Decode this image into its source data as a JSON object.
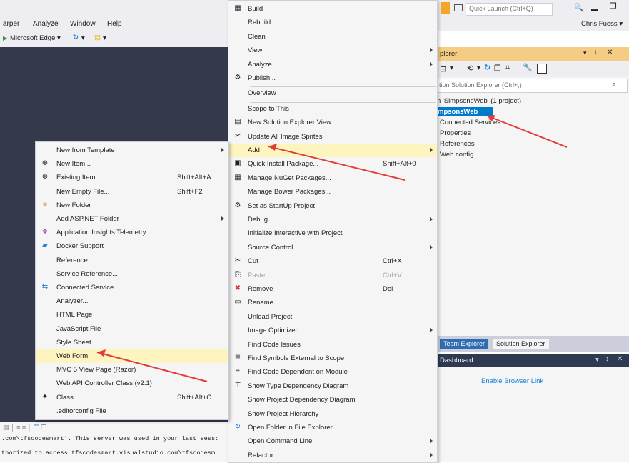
{
  "menubar": {
    "items": [
      "arper",
      "Analyze",
      "Window",
      "Help"
    ],
    "user": "Chris Fuess",
    "quick_launch_placeholder": "Quick Launch (Ctrl+Q)"
  },
  "toolbar": {
    "browser": "Microsoft Edge"
  },
  "solution_explorer": {
    "title": "plorer",
    "search_placeholder": "tion Solution Explorer (Ctrl+;)",
    "tree": {
      "solution": "n 'SimpsonsWeb' (1 project)",
      "project": "mpsonsWeb",
      "children": [
        "Connected Services",
        "Properties",
        "References",
        "Web.config"
      ]
    }
  },
  "tabs": [
    "Team Explorer",
    "Solution Explorer"
  ],
  "browser_link": {
    "title": "Dashboard",
    "link": "Enable Browser Link"
  },
  "output": {
    "lines": [
      ".com\\tfscodesmart'. This server was used in your last sess:",
      "thorized to access tfscodesmart.visualstudio.com\\tfscodesm"
    ]
  },
  "main_menu": [
    {
      "label": "Build",
      "icon": "build-icon"
    },
    {
      "label": "Rebuild"
    },
    {
      "label": "Clean"
    },
    {
      "label": "View",
      "submenu": true
    },
    {
      "label": "Analyze",
      "submenu": true
    },
    {
      "label": "Publish...",
      "icon": "publish-icon"
    },
    {
      "sep": true
    },
    {
      "label": "Overview"
    },
    {
      "sep": true
    },
    {
      "label": "Scope to This"
    },
    {
      "label": "New Solution Explorer View",
      "icon": "new-view-icon"
    },
    {
      "label": "Update All Image Sprites",
      "icon": "sprite-icon"
    },
    {
      "label": "Add",
      "submenu": true,
      "highlight": true
    },
    {
      "label": "Quick Install Package...",
      "shortcut": "Shift+Alt+0",
      "icon": "package-icon"
    },
    {
      "label": "Manage NuGet Packages...",
      "icon": "nuget-icon"
    },
    {
      "label": "Manage Bower Packages..."
    },
    {
      "label": "Set as StartUp Project",
      "icon": "gear-icon"
    },
    {
      "label": "Debug",
      "submenu": true
    },
    {
      "label": "Initialize Interactive with Project"
    },
    {
      "label": "Source Control",
      "submenu": true
    },
    {
      "label": "Cut",
      "shortcut": "Ctrl+X",
      "icon": "cut-icon"
    },
    {
      "label": "Paste",
      "shortcut": "Ctrl+V",
      "icon": "paste-icon",
      "disabled": true
    },
    {
      "label": "Remove",
      "shortcut": "Del",
      "icon": "remove-icon"
    },
    {
      "label": "Rename",
      "icon": "rename-icon"
    },
    {
      "label": "Unload Project"
    },
    {
      "label": "Image Optimizer",
      "submenu": true
    },
    {
      "label": "Find Code Issues"
    },
    {
      "label": "Find Symbols External to Scope",
      "icon": "symbols-icon"
    },
    {
      "label": "Find Code Dependent on Module",
      "icon": "dependency-icon"
    },
    {
      "label": "Show Type Dependency Diagram",
      "icon": "diagram-icon"
    },
    {
      "label": "Show Project Dependency Diagram"
    },
    {
      "label": "Show Project Hierarchy"
    },
    {
      "label": "Open Folder in File Explorer",
      "icon": "refresh-folder-icon"
    },
    {
      "label": "Open Command Line",
      "submenu": true
    },
    {
      "label": "Refactor",
      "submenu": true
    }
  ],
  "add_menu": [
    {
      "label": "New from Template",
      "submenu": true
    },
    {
      "label": "New Item...",
      "icon": "new-item-icon"
    },
    {
      "label": "Existing Item...",
      "shortcut": "Shift+Alt+A",
      "icon": "existing-item-icon"
    },
    {
      "label": "New Empty File...",
      "shortcut": "Shift+F2"
    },
    {
      "label": "New Folder",
      "icon": "folder-icon"
    },
    {
      "label": "Add ASP.NET Folder",
      "submenu": true
    },
    {
      "label": "Application Insights Telemetry...",
      "icon": "insights-icon"
    },
    {
      "label": "Docker Support",
      "icon": "docker-icon"
    },
    {
      "label": "Reference..."
    },
    {
      "label": "Service Reference..."
    },
    {
      "label": "Connected Service",
      "icon": "connected-service-icon"
    },
    {
      "label": "Analyzer..."
    },
    {
      "label": "HTML Page"
    },
    {
      "label": "JavaScript File"
    },
    {
      "label": "Style Sheet"
    },
    {
      "label": "Web Form",
      "highlight": true
    },
    {
      "label": "MVC 5 View Page (Razor)"
    },
    {
      "label": "Web API Controller Class (v2.1)"
    },
    {
      "label": "Class...",
      "shortcut": "Shift+Alt+C",
      "icon": "class-icon"
    },
    {
      "label": ".editorconfig File"
    }
  ]
}
